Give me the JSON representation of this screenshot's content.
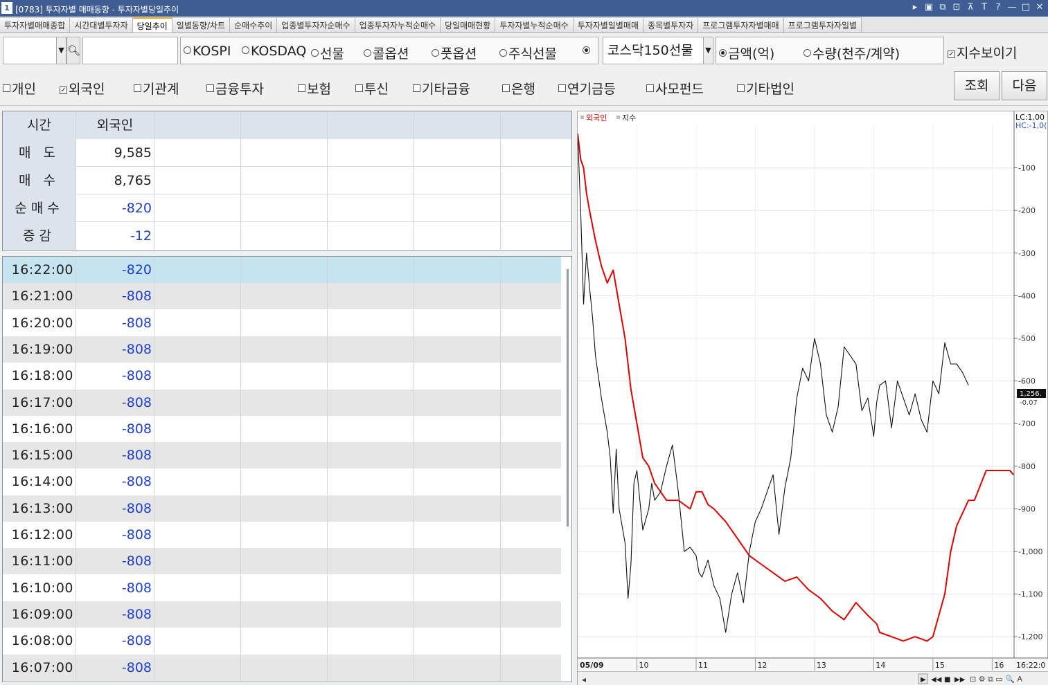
{
  "window": {
    "number": "1",
    "title": "[0783] 투자자별 매매동향 - 투자자별당일추이",
    "controls": [
      "▸",
      "▣",
      "⧉",
      "⊡",
      "⊼",
      "T",
      "?",
      "—",
      "□",
      "✕"
    ]
  },
  "tabs": [
    "투자자별매매종합",
    "시간대별투자자",
    "당일추이",
    "일별동향/차트",
    "순매수추이",
    "업종별투자자순매수",
    "업종투자자누적순매수",
    "당일매매현황",
    "투자자별누적순매수",
    "투자자별일별매매",
    "종목별투자자",
    "프로그램투자자별매매",
    "프로그램투자자일별"
  ],
  "active_tab": "당일추이",
  "controls": {
    "market_options": [
      {
        "label": "KOSPI",
        "selected": false
      },
      {
        "label": "KOSDAQ",
        "selected": false
      },
      {
        "label": "선물",
        "selected": false
      },
      {
        "label": "콜옵션",
        "selected": false
      },
      {
        "label": "풋옵션",
        "selected": false
      },
      {
        "label": "주식선물",
        "selected": false
      },
      {
        "label": "",
        "selected": true
      }
    ],
    "futures_select": "코스닥150선물",
    "unit_options": [
      {
        "label": "금액(억)",
        "selected": true
      },
      {
        "label": "수량(천주/계약)",
        "selected": false
      }
    ],
    "show_index": {
      "label": "지수보이기",
      "checked": true
    }
  },
  "investors": [
    {
      "label": "개인",
      "checked": false
    },
    {
      "label": "외국인",
      "checked": true
    },
    {
      "label": "기관계",
      "checked": false
    },
    {
      "label": "금융투자",
      "checked": false
    },
    {
      "label": "보험",
      "checked": false
    },
    {
      "label": "투신",
      "checked": false
    },
    {
      "label": "기타금융",
      "checked": false
    },
    {
      "label": "은행",
      "checked": false
    },
    {
      "label": "연기금등",
      "checked": false
    },
    {
      "label": "사모펀드",
      "checked": false
    },
    {
      "label": "기타법인",
      "checked": false
    }
  ],
  "buttons": {
    "query": "조회",
    "next": "다음"
  },
  "summary": {
    "headers": [
      "시간",
      "외국인"
    ],
    "rows": [
      {
        "label": "매 도",
        "value": "9,585",
        "color": "#222222"
      },
      {
        "label": "매 수",
        "value": "8,765",
        "color": "#222222"
      },
      {
        "label": "순매수",
        "value": "-820",
        "color": "#1f3fd0"
      },
      {
        "label": "증감",
        "value": "-12",
        "color": "#1f3fd0"
      }
    ]
  },
  "time_rows": [
    {
      "time": "16:22:00",
      "value": "-820"
    },
    {
      "time": "16:21:00",
      "value": "-808"
    },
    {
      "time": "16:20:00",
      "value": "-808"
    },
    {
      "time": "16:19:00",
      "value": "-808"
    },
    {
      "time": "16:18:00",
      "value": "-808"
    },
    {
      "time": "16:17:00",
      "value": "-808"
    },
    {
      "time": "16:16:00",
      "value": "-808"
    },
    {
      "time": "16:15:00",
      "value": "-808"
    },
    {
      "time": "16:14:00",
      "value": "-808"
    },
    {
      "time": "16:13:00",
      "value": "-808"
    },
    {
      "time": "16:12:00",
      "value": "-808"
    },
    {
      "time": "16:11:00",
      "value": "-808"
    },
    {
      "time": "16:10:00",
      "value": "-808"
    },
    {
      "time": "16:09:00",
      "value": "-808"
    },
    {
      "time": "16:08:00",
      "value": "-808"
    },
    {
      "time": "16:07:00",
      "value": "-808"
    }
  ],
  "colors": {
    "foreign_line": "#dd0000",
    "index_line": "#111111",
    "selected_row": "#c6e4f0",
    "stripe_row": "#e6e6e6",
    "negative_text": "#1f3fd0",
    "header_bg": "#dde3ec"
  },
  "chart_data": {
    "type": "line",
    "legend": [
      "외국인",
      "지수"
    ],
    "lc_label": "LC:1,00",
    "hc_label": "HC:-1,0(",
    "y_ticks": [
      -100,
      -200,
      -300,
      -400,
      -500,
      -600,
      -700,
      -800,
      -900,
      -1000,
      -1100,
      -1200
    ],
    "y_tick_labels": [
      "-100",
      "-200",
      "-300",
      "-400",
      "-500",
      "-600",
      "-700",
      "-800",
      "-900",
      "-1,000",
      "-1,100",
      "-1,200"
    ],
    "ylim": [
      -1250,
      0
    ],
    "x_ticks": [
      "05/09",
      "10",
      "11",
      "12",
      "13",
      "14",
      "15",
      "16",
      "16:22:0"
    ],
    "x_hours": [
      9,
      10,
      11,
      12,
      13,
      14,
      15,
      16
    ],
    "xlim": [
      9.0,
      16.37
    ],
    "current_index_label": "1,256.",
    "current_change_label": "-0.07",
    "series": [
      {
        "name": "외국인",
        "color": "#dd0000",
        "x": [
          9.0,
          9.05,
          9.1,
          9.15,
          9.2,
          9.3,
          9.4,
          9.5,
          9.6,
          9.7,
          9.8,
          9.9,
          10.0,
          10.1,
          10.2,
          10.3,
          10.5,
          10.7,
          10.9,
          11.0,
          11.1,
          11.2,
          11.3,
          11.5,
          11.7,
          11.9,
          12.1,
          12.3,
          12.5,
          12.7,
          12.9,
          13.1,
          13.3,
          13.5,
          13.7,
          13.9,
          14.05,
          14.1,
          14.3,
          14.5,
          14.7,
          14.9,
          15.0,
          15.1,
          15.2,
          15.3,
          15.4,
          15.6,
          15.7,
          15.9,
          16.1,
          16.3,
          16.36
        ],
        "y": [
          -20,
          -80,
          -100,
          -160,
          -200,
          -270,
          -330,
          -370,
          -340,
          -420,
          -500,
          -620,
          -700,
          -780,
          -800,
          -840,
          -880,
          -880,
          -900,
          -860,
          -860,
          -890,
          -900,
          -930,
          -970,
          -1010,
          -1030,
          -1050,
          -1070,
          -1060,
          -1090,
          -1110,
          -1140,
          -1160,
          -1120,
          -1150,
          -1170,
          -1190,
          -1200,
          -1210,
          -1200,
          -1210,
          -1200,
          -1150,
          -1100,
          -1000,
          -940,
          -880,
          -880,
          -810,
          -810,
          -810,
          -820
        ]
      },
      {
        "name": "지수",
        "color": "#111111",
        "x": [
          9.0,
          9.05,
          9.1,
          9.15,
          9.2,
          9.25,
          9.3,
          9.4,
          9.5,
          9.55,
          9.6,
          9.65,
          9.7,
          9.8,
          9.85,
          9.9,
          9.95,
          10.0,
          10.1,
          10.2,
          10.25,
          10.3,
          10.4,
          10.5,
          10.6,
          10.7,
          10.8,
          10.9,
          11.0,
          11.05,
          11.1,
          11.2,
          11.3,
          11.4,
          11.5,
          11.6,
          11.7,
          11.8,
          11.9,
          12.0,
          12.1,
          12.2,
          12.3,
          12.4,
          12.5,
          12.6,
          12.7,
          12.8,
          12.9,
          13.0,
          13.1,
          13.2,
          13.3,
          13.4,
          13.5,
          13.6,
          13.7,
          13.8,
          13.9,
          14.0,
          14.05,
          14.1,
          14.2,
          14.3,
          14.4,
          14.5,
          14.6,
          14.7,
          14.8,
          14.9,
          15.0,
          15.1,
          15.2,
          15.3,
          15.4,
          15.5,
          15.6
        ],
        "y": [
          -20,
          -200,
          -420,
          -300,
          -380,
          -450,
          -540,
          -640,
          -720,
          -780,
          -910,
          -760,
          -900,
          -980,
          -1110,
          -1030,
          -840,
          -810,
          -950,
          -900,
          -840,
          -880,
          -860,
          -800,
          -750,
          -860,
          -1000,
          -990,
          -1010,
          -1050,
          -1060,
          -1020,
          -1080,
          -1110,
          -1190,
          -1100,
          -1050,
          -1120,
          -1000,
          -930,
          -900,
          -860,
          -820,
          -960,
          -850,
          -780,
          -640,
          -570,
          -600,
          -500,
          -560,
          -680,
          -720,
          -660,
          -520,
          -540,
          -560,
          -670,
          -640,
          -730,
          -650,
          -610,
          -600,
          -710,
          -600,
          -640,
          -680,
          -630,
          -690,
          -720,
          -600,
          -630,
          -510,
          -560,
          -560,
          -580,
          -610
        ]
      }
    ]
  }
}
